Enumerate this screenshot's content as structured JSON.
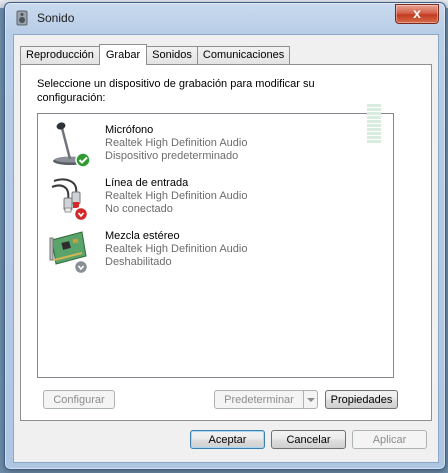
{
  "window": {
    "title": "Sonido",
    "close_label": "x"
  },
  "tabs": [
    {
      "label": "Reproducción",
      "active": false
    },
    {
      "label": "Grabar",
      "active": true
    },
    {
      "label": "Sonidos",
      "active": false
    },
    {
      "label": "Comunicaciones",
      "active": false
    }
  ],
  "instructions": "Seleccione un dispositivo de grabación para modificar su configuración:",
  "devices": [
    {
      "name": "Micrófono",
      "driver": "Realtek High Definition Audio",
      "status": "Dispositivo predeterminado",
      "icon": "microphone-icon",
      "badge": "check"
    },
    {
      "name": "Línea de entrada",
      "driver": "Realtek High Definition Audio",
      "status": "No conectado",
      "icon": "line-in-cable-icon",
      "badge": "red-down"
    },
    {
      "name": "Mezcla estéreo",
      "driver": "Realtek High Definition Audio",
      "status": "Deshabilitado",
      "icon": "sound-card-icon",
      "badge": "gray-down"
    }
  ],
  "panel_buttons": {
    "configure": "Configurar",
    "set_default": "Predeterminar",
    "properties": "Propiedades"
  },
  "dialog_buttons": {
    "accept": "Aceptar",
    "cancel": "Cancelar",
    "apply": "Aplicar"
  },
  "colors": {
    "check_badge": "#2e9b2e",
    "red_badge": "#d22a2a",
    "level_meter": "#d8ede0"
  }
}
